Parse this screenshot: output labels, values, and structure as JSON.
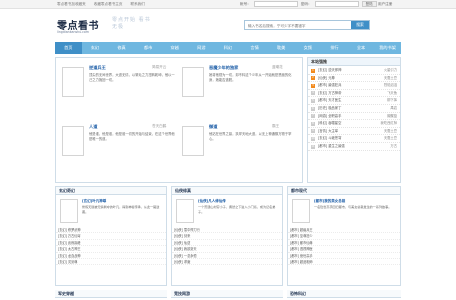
{
  "topbar": {
    "links": [
      "零点看书加收藏夹",
      "收藏零点看书主页",
      "联系我们"
    ],
    "account_label": "帐号：",
    "password_label": "密码：",
    "login_label": "登陆",
    "register_label": "用户注册"
  },
  "header": {
    "logo_title": "零点看书",
    "logo_url": "lingdiankanshu.com",
    "slogan": "零点开始 看书无极",
    "search_placeholder": "输入书名后搜索，宁可少字不要错字",
    "search_button": "搜索"
  },
  "nav": {
    "items": [
      "首页",
      "玄幻",
      "修真",
      "都市",
      "穿越",
      "网游",
      "科幻",
      "言情",
      "耽美",
      "女频",
      "排行",
      "全本",
      "我的书架"
    ],
    "active_index": 0
  },
  "featured": [
    {
      "title": "逆道兵王",
      "author": "简易开云",
      "desc": "顶尖的无间世界，大道无情，以毫毛之力扭转乾坤，他以一己之力挽回一切。"
    },
    {
      "title": "恶魔少年的独家",
      "author": "蓝曦花",
      "desc": "她将他视为一切，却不料这个少年从一开始就是恶魔的化身，她能否逃脱。"
    },
    {
      "title": "人道",
      "author": "苍天白鹤",
      "desc": "他是谁，他是谁，他是谁一切的开始与结束，在这个世界他是唯一的道。"
    },
    {
      "title": "御道",
      "author": "霸王",
      "desc": "他站在世界之巅，执掌天地大道，以无上神通御万物于掌心。"
    }
  ],
  "rank": {
    "title": "本站强推",
    "items": [
      {
        "name": "[玄幻] 逆天邪神",
        "author": "火星引力"
      },
      {
        "name": "[仙侠] 元尊",
        "author": "天蚕土豆"
      },
      {
        "name": "[都市] 最强狂兵",
        "author": "烈焰滔滔"
      },
      {
        "name": "[玄幻] 万古神帝",
        "author": "飞天鱼"
      },
      {
        "name": "[都市] 天才医生",
        "author": "柳下挥"
      },
      {
        "name": "[历史] 极品家丁",
        "author": "禹岩"
      },
      {
        "name": "[网游] 全职高手",
        "author": "蝴蝶蓝"
      },
      {
        "name": "[科幻] 吞噬星空",
        "author": "我吃西红柿"
      },
      {
        "name": "[言情] 大主宰",
        "author": "天蚕土豆"
      },
      {
        "name": "[玄幻] 斗破苍穹",
        "author": "天蚕土豆"
      },
      {
        "name": "[都市] 重生之最强",
        "author": "万古"
      }
    ]
  },
  "categories": [
    {
      "head": "玄幻奇幻",
      "feature_title": "[玄幻]叶凡神尊",
      "feature_desc": "修炼天赋被无情剥夺的叶凡，得到神秘传承，从此一路逆袭。",
      "rows": [
        "[玄幻] 修罗武神",
        "[玄幻] 万古仙穹",
        "[玄幻] 武炼巅峰",
        "[玄幻] 太古神王",
        "[玄幻] 龙血战神",
        "[玄幻] 灵剑尊"
      ]
    },
    {
      "head": "仙侠修真",
      "feature_title": "[仙侠]凡人修仙传",
      "feature_desc": "一个普通山村穷小子，偶然之下进入小门派，成为记名弟子。",
      "rows": [
        "[仙侠] 雪中悍刀行",
        "[仙侠] 剑来",
        "[仙侠] 仙逆",
        "[仙侠] 我欲封天",
        "[仙侠] 一念永恒",
        "[仙侠] 求魔"
      ]
    },
    {
      "head": "都市现代",
      "feature_title": "[都市]我的美女总裁",
      "feature_desc": "一名隐世高手回归都市，与美女总裁发生的一系列故事。",
      "rows": [
        "[都市] 超级兵王",
        "[都市] 至尊狂少",
        "[都市] 都市仙尊",
        "[都市] 透视神医",
        "[都市] 绝世高手",
        "[都市] 超品相师"
      ]
    }
  ],
  "bottom_heads": [
    "军史穿越",
    "竞技网游",
    "恐怖科幻"
  ]
}
